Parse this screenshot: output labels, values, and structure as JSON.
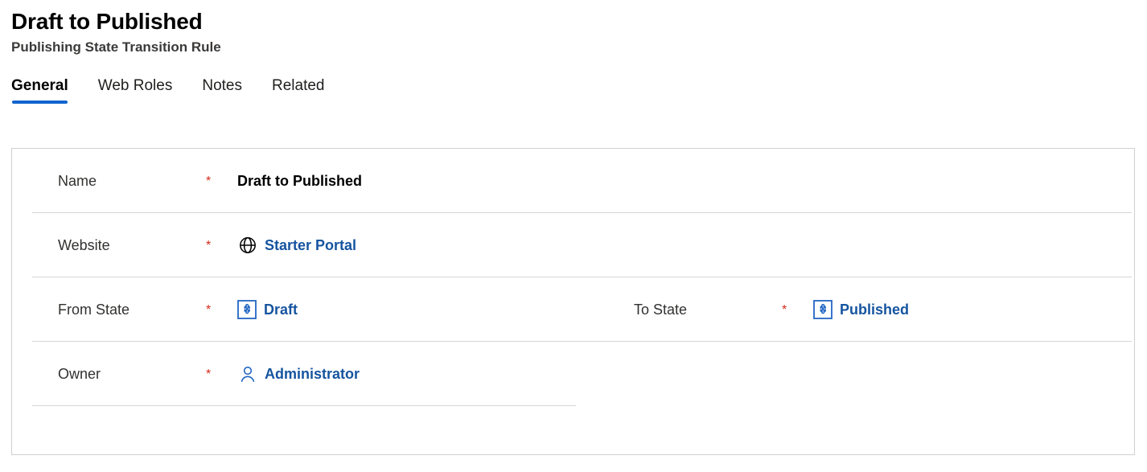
{
  "header": {
    "title": "Draft to Published",
    "subtitle": "Publishing State Transition Rule"
  },
  "tabs": [
    {
      "label": "General",
      "selected": true
    },
    {
      "label": "Web Roles",
      "selected": false
    },
    {
      "label": "Notes",
      "selected": false
    },
    {
      "label": "Related",
      "selected": false
    }
  ],
  "form": {
    "required_marker": "*",
    "rows": [
      {
        "left": {
          "label": "Name",
          "required": true,
          "value": "Draft to Published",
          "value_type": "text",
          "icon": null
        },
        "right": null,
        "separator": "full"
      },
      {
        "left": {
          "label": "Website",
          "required": true,
          "value": "Starter Portal",
          "value_type": "link",
          "icon": "globe-icon"
        },
        "right": null,
        "separator": "full"
      },
      {
        "left": {
          "label": "From State",
          "required": true,
          "value": "Draft",
          "value_type": "link",
          "icon": "entity-icon"
        },
        "right": {
          "label": "To State",
          "required": true,
          "value": "Published",
          "value_type": "link",
          "icon": "entity-icon"
        },
        "separator": "full"
      },
      {
        "left": {
          "label": "Owner",
          "required": true,
          "value": "Administrator",
          "value_type": "link",
          "icon": "person-icon"
        },
        "right": null,
        "separator": "half"
      }
    ]
  },
  "colors": {
    "accent": "#1264cd",
    "link": "#15549f",
    "required": "#d52b1e",
    "label": "#323130",
    "border": "#d2d0ce",
    "separator": "#d8d6d4",
    "icon_blue": "#2266c4",
    "icon_black": "#000000"
  }
}
